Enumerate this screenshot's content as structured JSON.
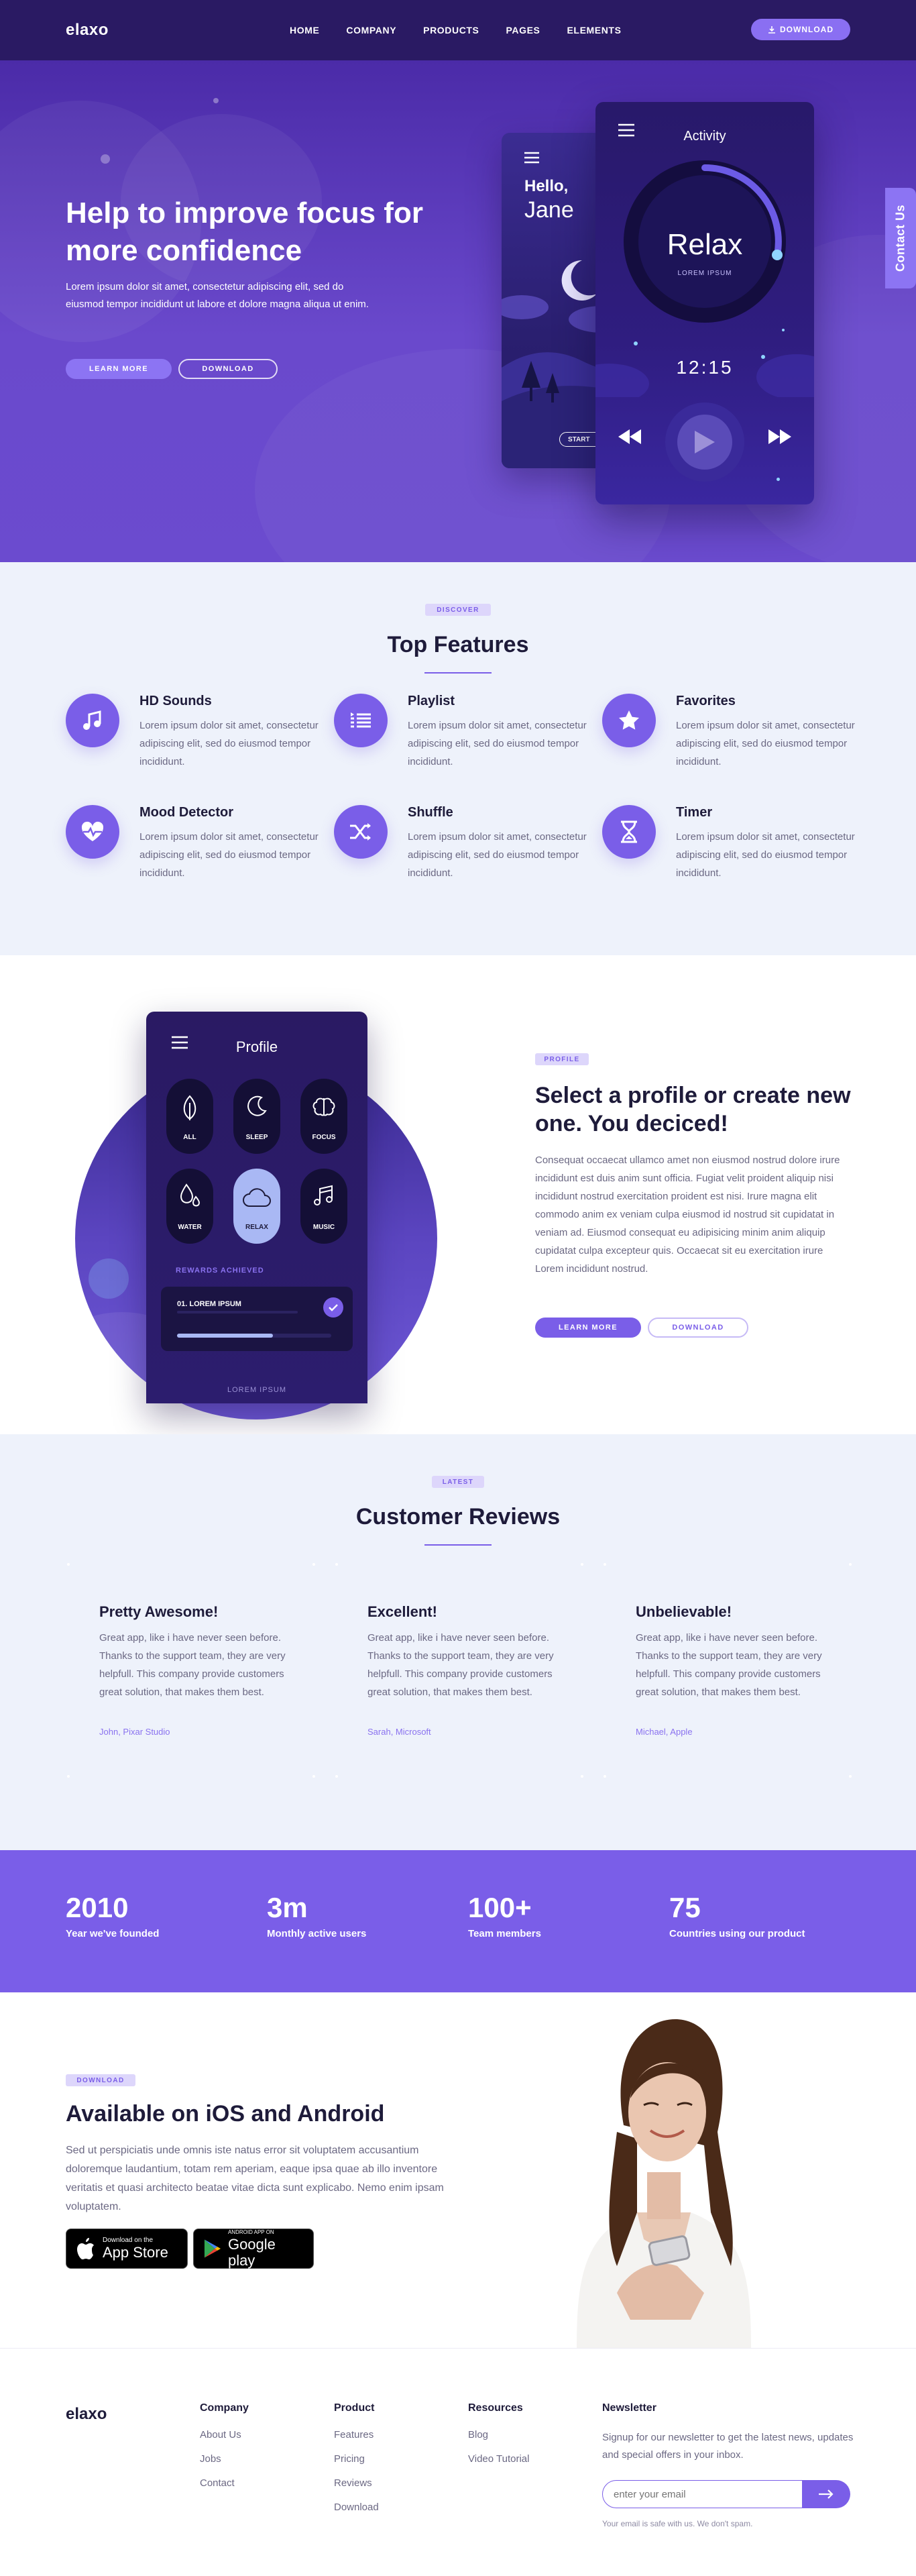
{
  "nav": {
    "logo": "elaxo",
    "items": [
      "HOME",
      "COMPANY",
      "PRODUCTS",
      "PAGES",
      "ELEMENTS"
    ],
    "download_label": "DOWNLOAD"
  },
  "hero": {
    "title": "Help to improve focus for more confidence",
    "text": "Lorem ipsum dolor sit amet, consectetur adipiscing elit, sed do eiusmod tempor incididunt ut labore et dolore magna aliqua ut enim.",
    "learn_more": "LEARN MORE",
    "download": "DOWNLOAD",
    "contact_tab": "Contact Us",
    "phone_small": {
      "greeting": "Hello,",
      "name": "Jane",
      "start": "START"
    },
    "phone_big": {
      "title": "Activity",
      "mode": "Relax",
      "sub": "LOREM IPSUM",
      "time": "12:15"
    }
  },
  "features": {
    "tag": "DISCOVER",
    "title": "Top Features",
    "items": [
      {
        "title": "HD Sounds",
        "text": "Lorem ipsum dolor sit amet, consectetur adipiscing elit, sed do eiusmod tempor incididunt.",
        "icon": "music-note-icon"
      },
      {
        "title": "Playlist",
        "text": "Lorem ipsum dolor sit amet, consectetur adipiscing elit, sed do eiusmod tempor incididunt.",
        "icon": "playlist-icon"
      },
      {
        "title": "Favorites",
        "text": "Lorem ipsum dolor sit amet, consectetur adipiscing elit, sed do eiusmod tempor incididunt.",
        "icon": "star-icon"
      },
      {
        "title": "Mood Detector",
        "text": "Lorem ipsum dolor sit amet, consectetur adipiscing elit, sed do eiusmod tempor incididunt.",
        "icon": "heart-pulse-icon"
      },
      {
        "title": "Shuffle",
        "text": "Lorem ipsum dolor sit amet, consectetur adipiscing elit, sed do eiusmod tempor incididunt.",
        "icon": "shuffle-icon"
      },
      {
        "title": "Timer",
        "text": "Lorem ipsum dolor sit amet, consectetur adipiscing elit, sed do eiusmod tempor incididunt.",
        "icon": "hourglass-icon"
      }
    ]
  },
  "profile": {
    "tag": "PROFILE",
    "title": "Select a profile or create new one. You deciced!",
    "text": "Consequat occaecat ullamco amet non eiusmod nostrud dolore irure incididunt est duis anim sunt officia. Fugiat velit proident aliquip nisi incididunt nostrud exercitation proident est nisi. Irure magna elit commodo anim ex veniam culpa eiusmod id nostrud sit cupidatat in veniam ad. Eiusmod consequat eu adipisicing minim anim aliquip cupidatat culpa excepteur quis. Occaecat sit eu exercitation irure Lorem incididunt nostrud.",
    "learn_more": "LEARN MORE",
    "download": "DOWNLOAD",
    "app": {
      "title": "Profile",
      "options": [
        "ALL",
        "SLEEP",
        "FOCUS",
        "WATER",
        "RELAX",
        "MUSIC"
      ],
      "rewards_label": "REWARDS ACHIEVED",
      "reward_item": "01. LOREM IPSUM",
      "reward_progress": 0.62,
      "bottom": "LOREM IPSUM"
    }
  },
  "reviews": {
    "tag": "LATEST",
    "title": "Customer Reviews",
    "items": [
      {
        "title": "Pretty Awesome!",
        "text": "Great app, like i have never seen before. Thanks to the support team, they are very helpfull. This company provide customers great solution, that makes them best.",
        "author": "John, Pixar Studio"
      },
      {
        "title": "Excellent!",
        "text": "Great app, like i have never seen before. Thanks to the support team, they are very helpfull. This company provide customers great solution, that makes them best.",
        "author": "Sarah, Microsoft"
      },
      {
        "title": "Unbelievable!",
        "text": "Great app, like i have never seen before. Thanks to the support team, they are very helpfull. This company provide customers great solution, that makes them best.",
        "author": "Michael, Apple"
      }
    ]
  },
  "stats": [
    {
      "value": "2010",
      "label": "Year we've founded"
    },
    {
      "value": "3m",
      "label": "Monthly active users"
    },
    {
      "value": "100+",
      "label": "Team members"
    },
    {
      "value": "75",
      "label": "Countries using our product"
    }
  ],
  "download": {
    "tag": "DOWNLOAD",
    "title": "Available on iOS and Android",
    "text": "Sed ut perspiciatis unde omnis iste natus error sit voluptatem accusantium doloremque laudantium, totam rem aperiam, eaque ipsa quae ab illo inventore veritatis et quasi architecto beatae vitae dicta sunt explicabo. Nemo enim ipsam voluptatem.",
    "appstore": {
      "line1": "Download on the",
      "line2": "App Store"
    },
    "googleplay": {
      "line1": "ANDROID APP ON",
      "line2": "Google play"
    }
  },
  "footer": {
    "logo": "elaxo",
    "columns": [
      {
        "title": "Company",
        "links": [
          "About Us",
          "Jobs",
          "Contact"
        ]
      },
      {
        "title": "Product",
        "links": [
          "Features",
          "Pricing",
          "Reviews",
          "Download"
        ]
      },
      {
        "title": "Resources",
        "links": [
          "Blog",
          "Video Tutorial"
        ]
      }
    ],
    "newsletter": {
      "title": "Newsletter",
      "text": "Signup for our newsletter to get the latest news, updates and special offers in your inbox.",
      "placeholder": "enter your email",
      "note": "Your email is safe with us. We don't spam."
    }
  },
  "colors": {
    "primary": "#7a5ee8",
    "nav": "#2a1a63",
    "hero": "#5a3bbd",
    "light_bg": "#eef2fb"
  }
}
